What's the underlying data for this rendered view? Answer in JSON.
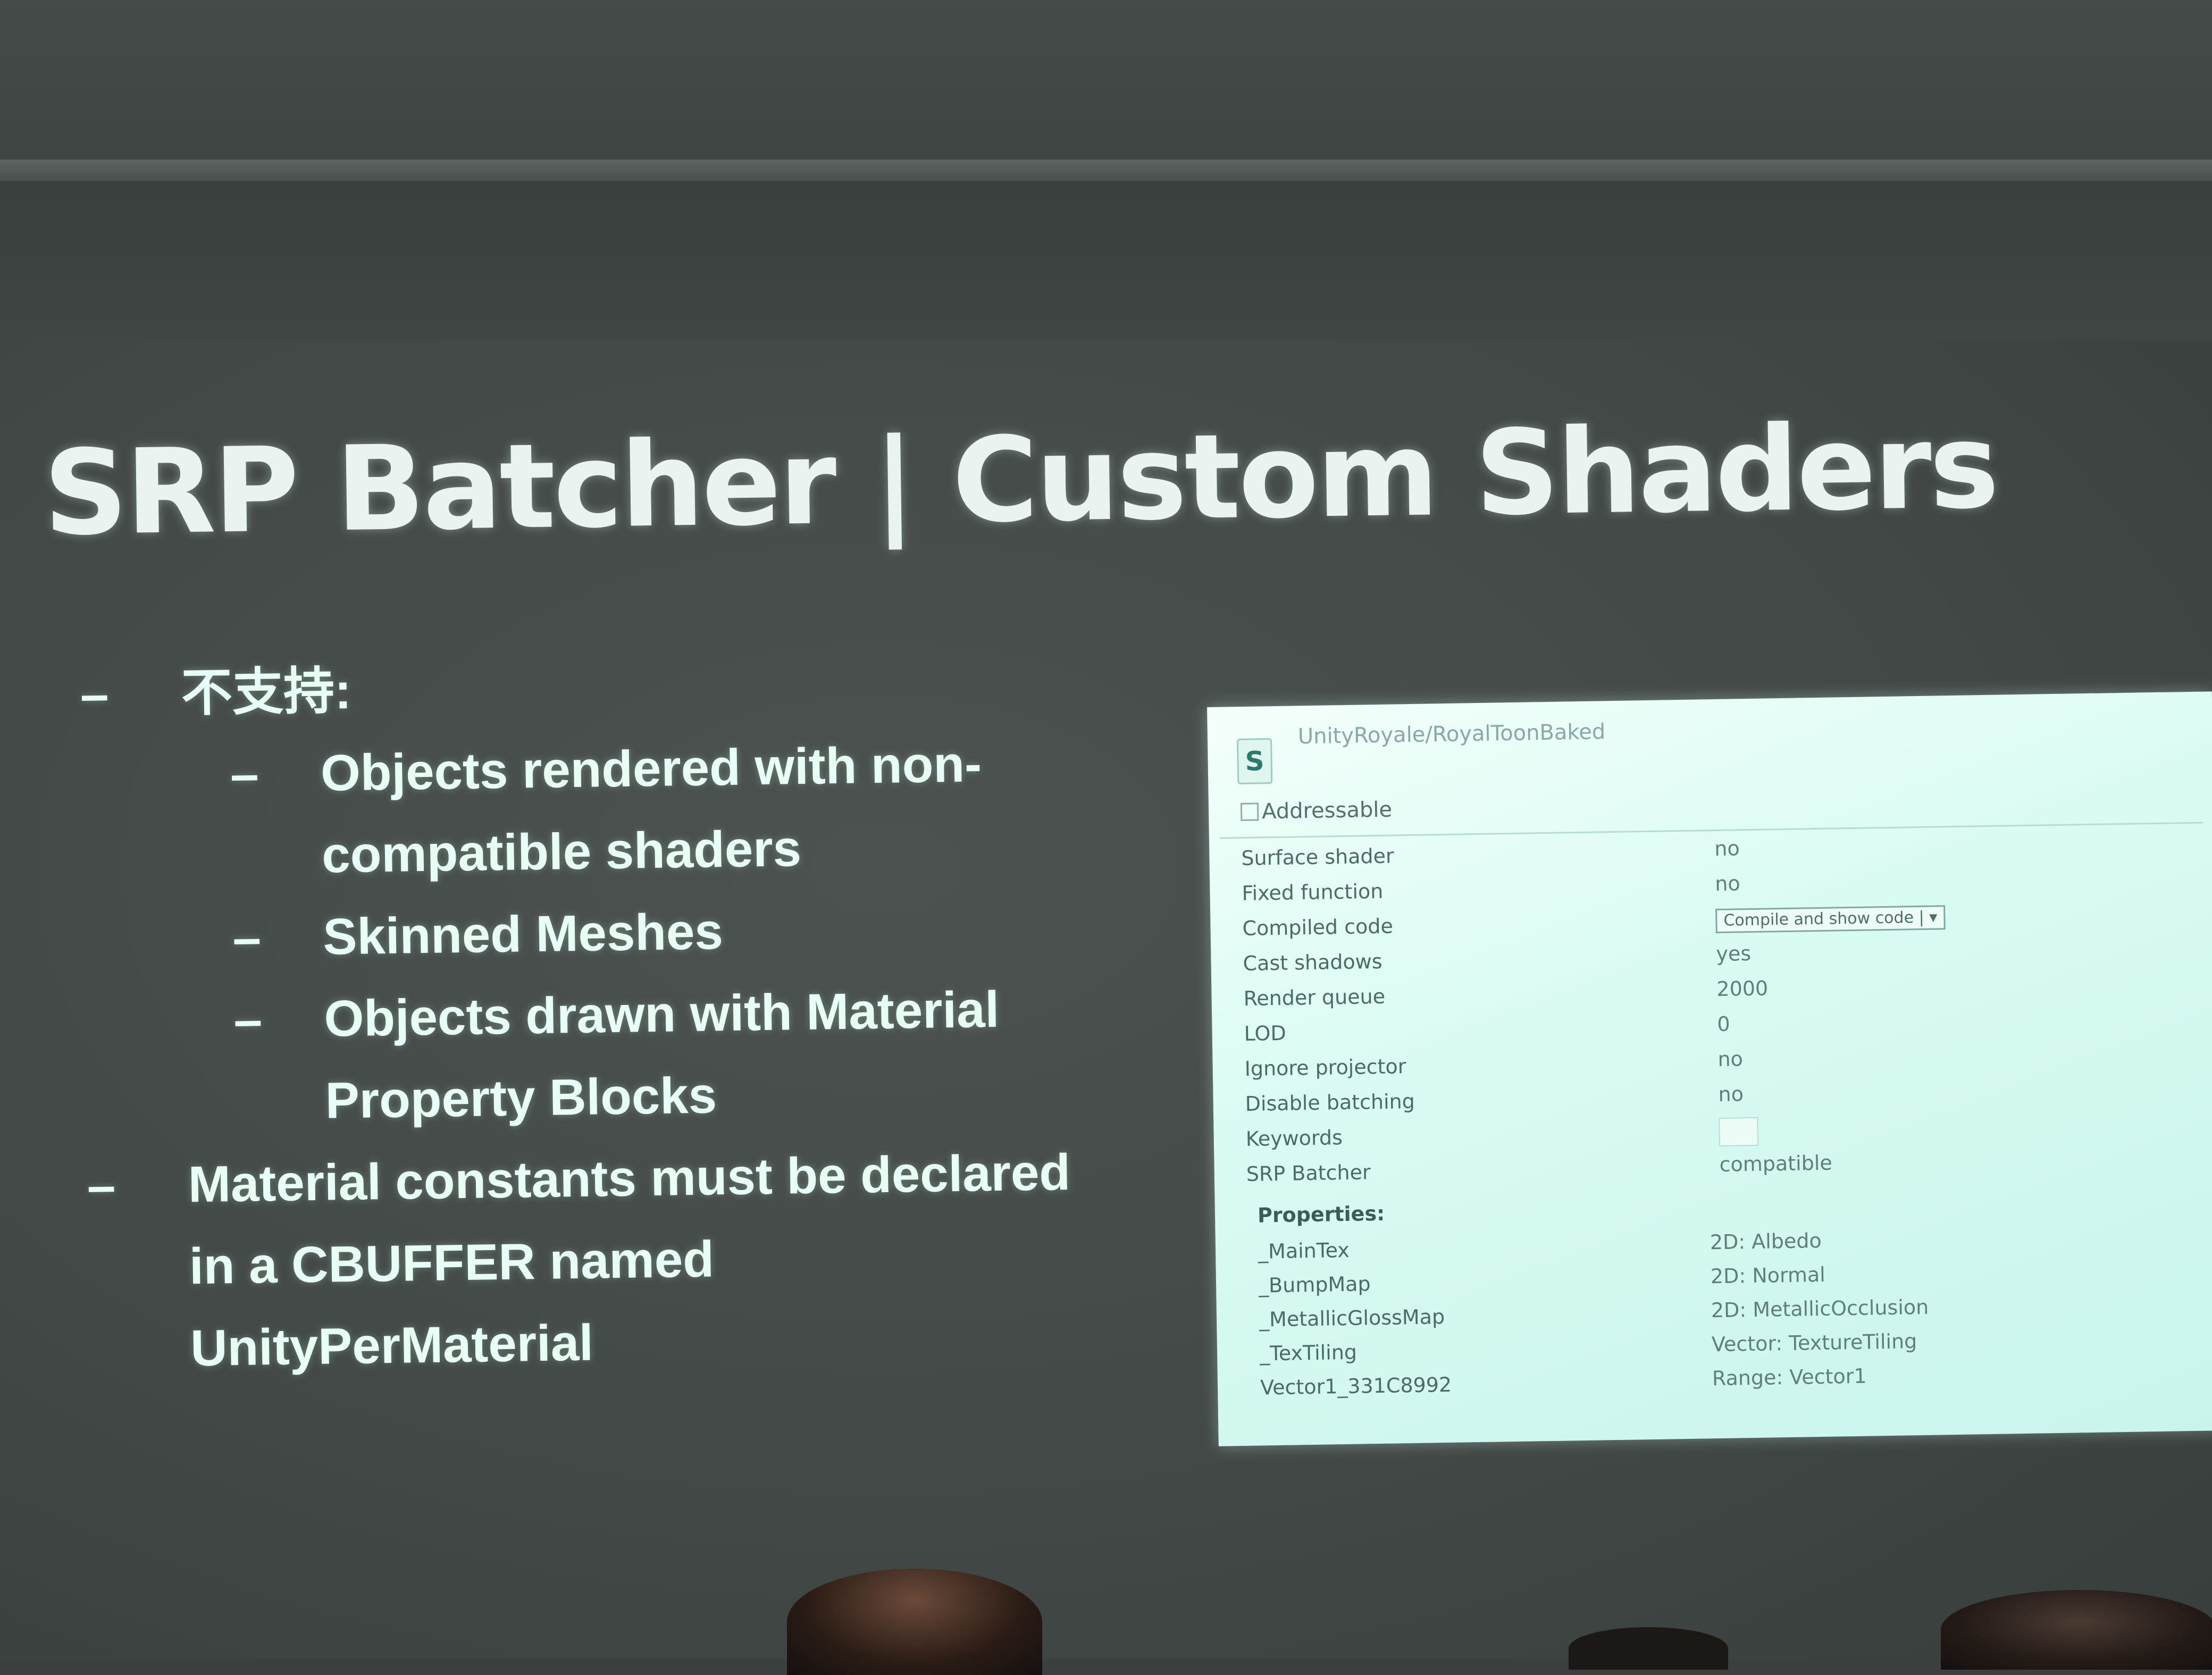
{
  "slide": {
    "title": "SRP Batcher | Custom Shaders",
    "dash": "–",
    "bullets": {
      "not_supported": "不支持:",
      "sub1_line1": "Objects rendered with non-",
      "sub1_line2": "compatible shaders",
      "sub2": "Skinned Meshes",
      "sub3_line1": "Objects drawn with Material",
      "sub3_line2": "Property Blocks",
      "main2_line1": "Material constants must be declared",
      "main2_line2": "in a CBUFFER named",
      "main2_line3": "UnityPerMaterial"
    }
  },
  "inspector": {
    "icon_letter": "S",
    "shader_name": "UnityRoyale/RoyalToonBaked",
    "addressable_label": "Addressable",
    "rows": [
      {
        "label": "Surface shader",
        "value": "no"
      },
      {
        "label": "Fixed function",
        "value": "no"
      },
      {
        "label": "Compiled code",
        "value": "Compile and show code | ▾"
      },
      {
        "label": "Cast shadows",
        "value": "yes"
      },
      {
        "label": "Render queue",
        "value": "2000"
      },
      {
        "label": "LOD",
        "value": "0"
      },
      {
        "label": "Ignore projector",
        "value": "no"
      },
      {
        "label": "Disable batching",
        "value": "no"
      },
      {
        "label": "Keywords",
        "value": ""
      },
      {
        "label": "SRP Batcher",
        "value": "compatible"
      }
    ],
    "properties_heading": "Properties:",
    "properties": [
      {
        "label": "_MainTex",
        "value": "2D: Albedo"
      },
      {
        "label": "_BumpMap",
        "value": "2D: Normal"
      },
      {
        "label": "_MetallicGlossMap",
        "value": "2D: MetallicOcclusion"
      },
      {
        "label": "_TexTiling",
        "value": "Vector: TextureTiling"
      },
      {
        "label": "Vector1_331C8992",
        "value": "Range: Vector1"
      }
    ]
  }
}
